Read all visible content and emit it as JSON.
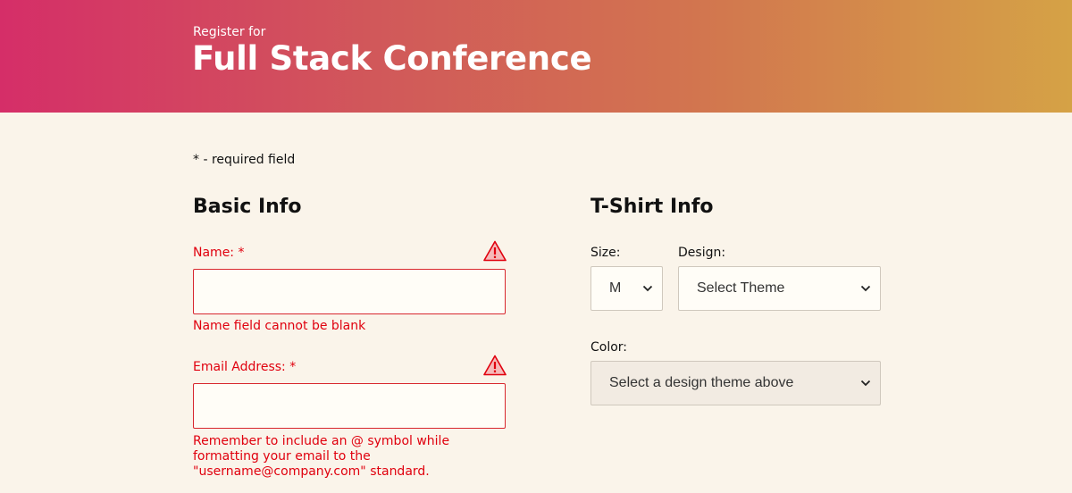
{
  "header": {
    "subtitle": "Register for",
    "title": "Full Stack Conference"
  },
  "required_note": "* - required field",
  "basic_info": {
    "heading": "Basic Info",
    "name": {
      "label": "Name: *",
      "value": "",
      "error": "Name field cannot be blank"
    },
    "email": {
      "label": "Email Address: *",
      "value": "",
      "error": "Remember to include an @ symbol while formatting your email to the \"username@company.com\" standard."
    }
  },
  "tshirt_info": {
    "heading": "T-Shirt Info",
    "size": {
      "label": "Size:",
      "selected": "M"
    },
    "design": {
      "label": "Design:",
      "selected": "Select Theme"
    },
    "color": {
      "label": "Color:",
      "selected": "Select a design theme above"
    }
  },
  "icons": {
    "warning": "warning-icon",
    "dropdown": "chevron-down-icon"
  },
  "colors": {
    "error": "#e0000e",
    "background": "#faf4ea",
    "gradient_start": "#d52e68",
    "gradient_end": "#d5a246"
  }
}
